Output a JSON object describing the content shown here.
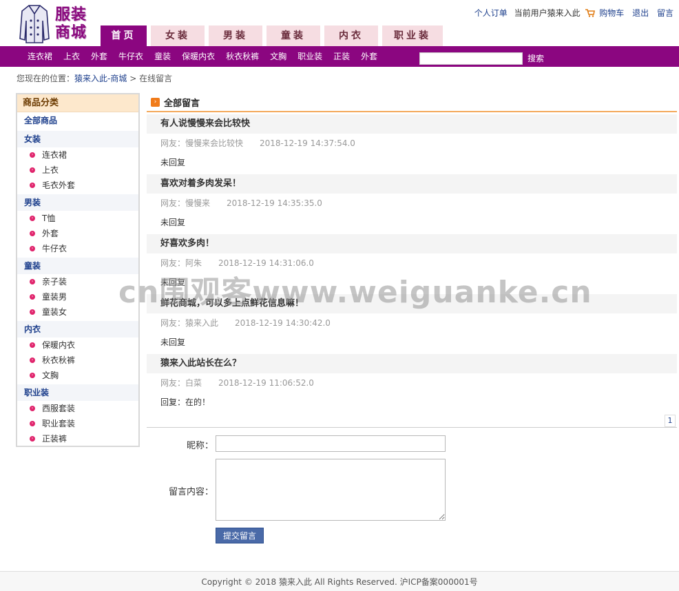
{
  "logo": {
    "line1": "服装",
    "line2": "商城",
    "icon": "coat-icon"
  },
  "toplinks": {
    "orders": "个人订单",
    "current_user": "当前用户猿来入此",
    "cart": "购物车",
    "logout": "退出",
    "guestbook": "留言"
  },
  "main_tabs": [
    "首页",
    "女装",
    "男装",
    "童装",
    "内衣",
    "职业装"
  ],
  "sub_nav": [
    "连衣裙",
    "上衣",
    "外套",
    "牛仔衣",
    "童装",
    "保暖内衣",
    "秋衣秋裤",
    "文胸",
    "职业装",
    "正装",
    "外套"
  ],
  "search": {
    "button": "搜索",
    "value": ""
  },
  "breadcrumb": {
    "prefix": "您现在的位置：",
    "home": "猿来入此-商城",
    "sep": ">",
    "current": "在线留言"
  },
  "sidebar": {
    "title": "商品分类",
    "all": "全部商品",
    "categories": [
      {
        "name": "女装",
        "items": [
          "连衣裙",
          "上衣",
          "毛衣外套"
        ]
      },
      {
        "name": "男装",
        "items": [
          "T恤",
          "外套",
          "牛仔衣"
        ]
      },
      {
        "name": "童装",
        "items": [
          "亲子装",
          "童装男",
          "童装女"
        ]
      },
      {
        "name": "内衣",
        "items": [
          "保暖内衣",
          "秋衣秋裤",
          "文胸"
        ]
      },
      {
        "name": "职业装",
        "items": [
          "西服套装",
          "职业套装",
          "正装裤"
        ]
      }
    ]
  },
  "main": {
    "title": "全部留言",
    "messages": [
      {
        "title": "有人说慢慢来会比较快",
        "author": "网友：慢慢来会比较快",
        "time": "2018-12-19 14:37:54.0",
        "reply": "未回复"
      },
      {
        "title": "喜欢对着多肉发呆！",
        "author": "网友：慢慢来",
        "time": "2018-12-19 14:35:35.0",
        "reply": "未回复"
      },
      {
        "title": "好喜欢多肉！",
        "author": "网友：阿朱",
        "time": "2018-12-19 14:31:06.0",
        "reply": "未回复"
      },
      {
        "title": "鲜花商城，可以多上点鲜花信息嘛！",
        "author": "网友：猿来入此",
        "time": "2018-12-19 14:30:42.0",
        "reply": "未回复"
      },
      {
        "title": "猿来入此站长在么？",
        "author": "网友：白菜",
        "time": "2018-12-19 11:06:52.0",
        "reply": "回复：在的！"
      }
    ],
    "page": "1"
  },
  "form": {
    "nickname_label": "昵称：",
    "content_label": "留言内容：",
    "submit": "提交留言"
  },
  "footer": "Copyright © 2018 猿来入此 All Rights Reserved. 沪ICP备案000001号",
  "watermark": "cn围观客www.weiguanke.cn",
  "colors": {
    "brand": "#8b0680",
    "tab_inactive": "#f6dde2",
    "accent": "#f4a95a",
    "link": "#1d3f8c"
  }
}
